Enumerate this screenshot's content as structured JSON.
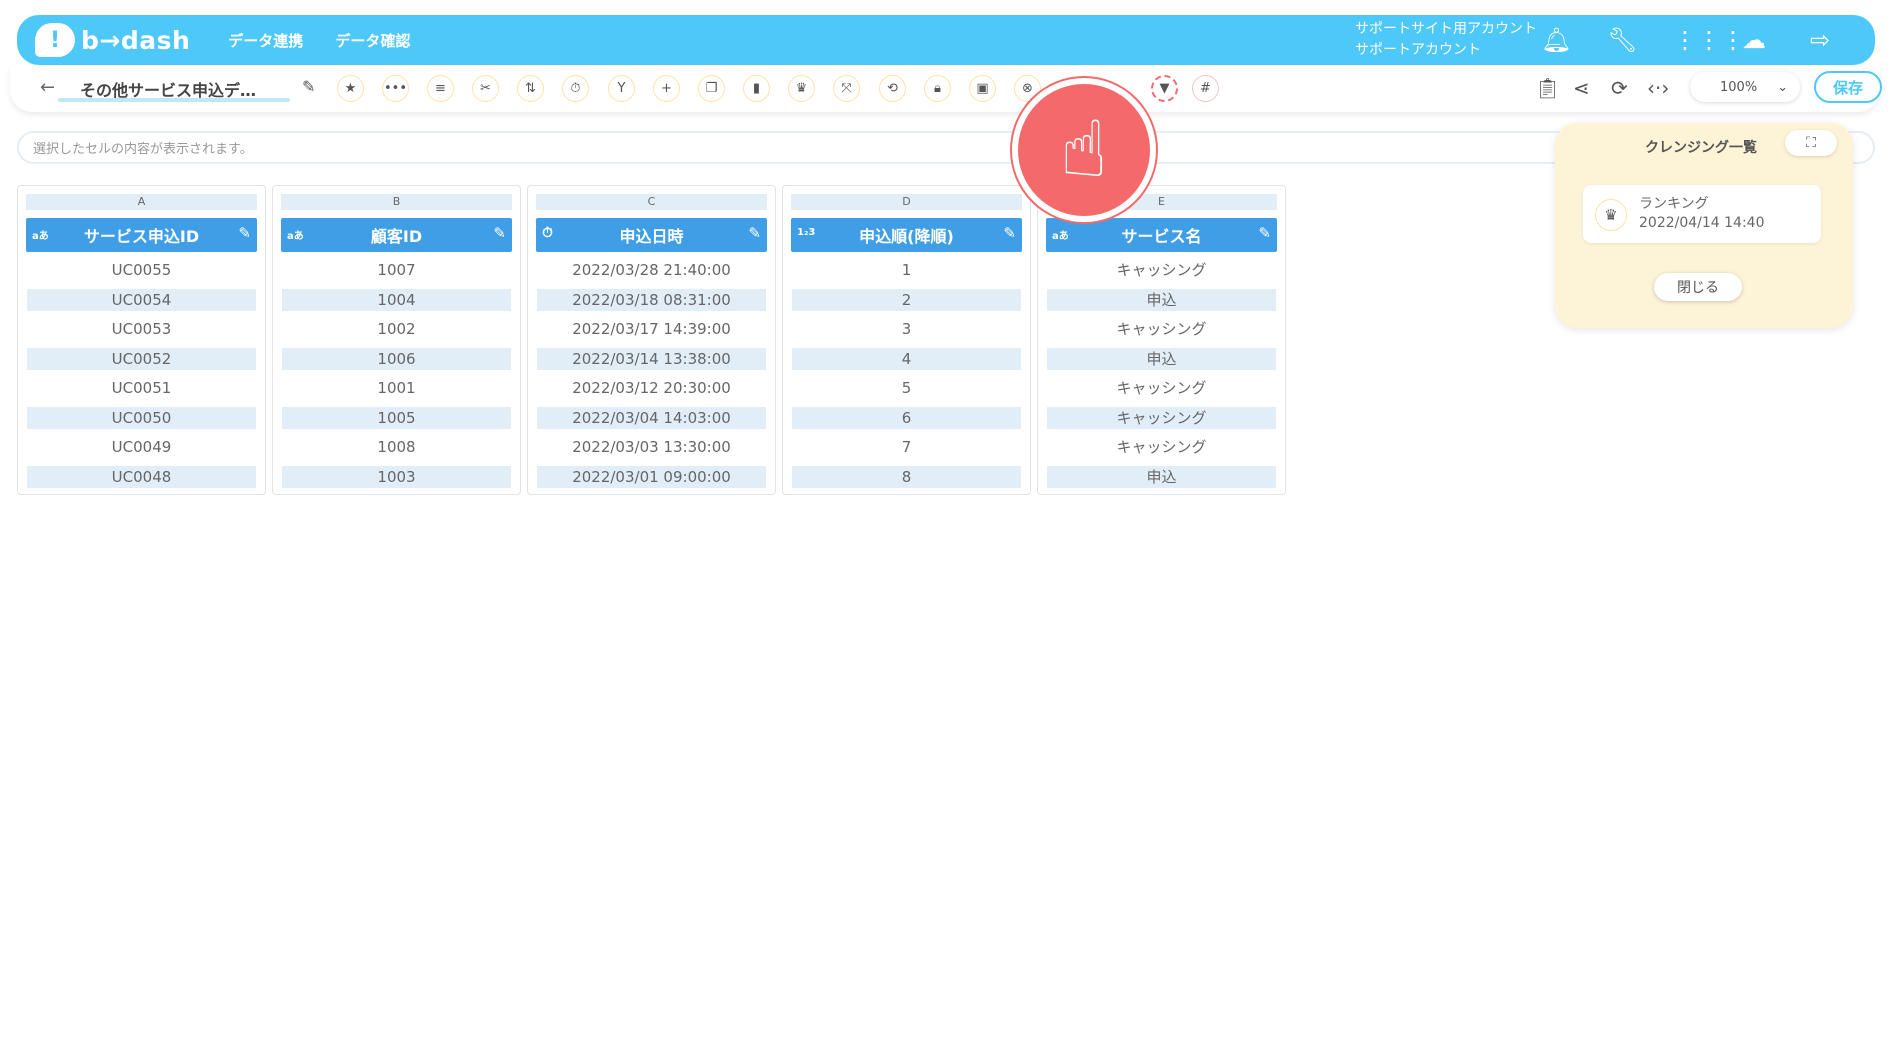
{
  "header": {
    "logo_text": "b→dash",
    "nav": [
      "データ連携",
      "データ確認"
    ],
    "account_line1": "サポートサイト用アカウント",
    "account_line2": "サポートアカウント",
    "icons": [
      "bell-icon",
      "wrench-icon",
      "grid-icon",
      "robot-icon",
      "logout-icon"
    ]
  },
  "toolbar": {
    "back_glyph": "←",
    "title": "その他サービス申込デ…",
    "tools": [
      "star",
      "more",
      "list",
      "cut",
      "tool",
      "timer",
      "branch",
      "add",
      "copy",
      "delete",
      "crown",
      "expand",
      "repeat",
      "lock",
      "box",
      "cancel",
      "filter",
      "grid"
    ],
    "zoom": "100%",
    "save_label": "保存"
  },
  "cellbar": {
    "placeholder": "選択したセルの内容が表示されます。"
  },
  "columns": [
    {
      "letter": "A",
      "type": "aあ",
      "name": "サービス申込ID",
      "cells": [
        "UC0055",
        "UC0054",
        "UC0053",
        "UC0052",
        "UC0051",
        "UC0050",
        "UC0049",
        "UC0048"
      ]
    },
    {
      "letter": "B",
      "type": "aあ",
      "name": "顧客ID",
      "cells": [
        "1007",
        "1004",
        "1002",
        "1006",
        "1001",
        "1005",
        "1008",
        "1003"
      ]
    },
    {
      "letter": "C",
      "type": "⏱",
      "name": "申込日時",
      "cells": [
        "2022/03/28 21:40:00",
        "2022/03/18 08:31:00",
        "2022/03/17 14:39:00",
        "2022/03/14 13:38:00",
        "2022/03/12 20:30:00",
        "2022/03/04 14:03:00",
        "2022/03/03 13:30:00",
        "2022/03/01 09:00:00"
      ]
    },
    {
      "letter": "D",
      "type": "1₂3",
      "name": "申込順(降順)",
      "cells": [
        "1",
        "2",
        "3",
        "4",
        "5",
        "6",
        "7",
        "8"
      ]
    },
    {
      "letter": "E",
      "type": "aあ",
      "name": "サービス名",
      "cells": [
        "キャッシング",
        "申込",
        "キャッシング",
        "申込",
        "キャッシング",
        "キャッシング",
        "キャッシング",
        "申込"
      ]
    }
  ],
  "panel": {
    "title": "クレンジング一覧",
    "item_name": "ランキング",
    "item_date": "2022/04/14 14:40",
    "close_label": "閉じる"
  }
}
